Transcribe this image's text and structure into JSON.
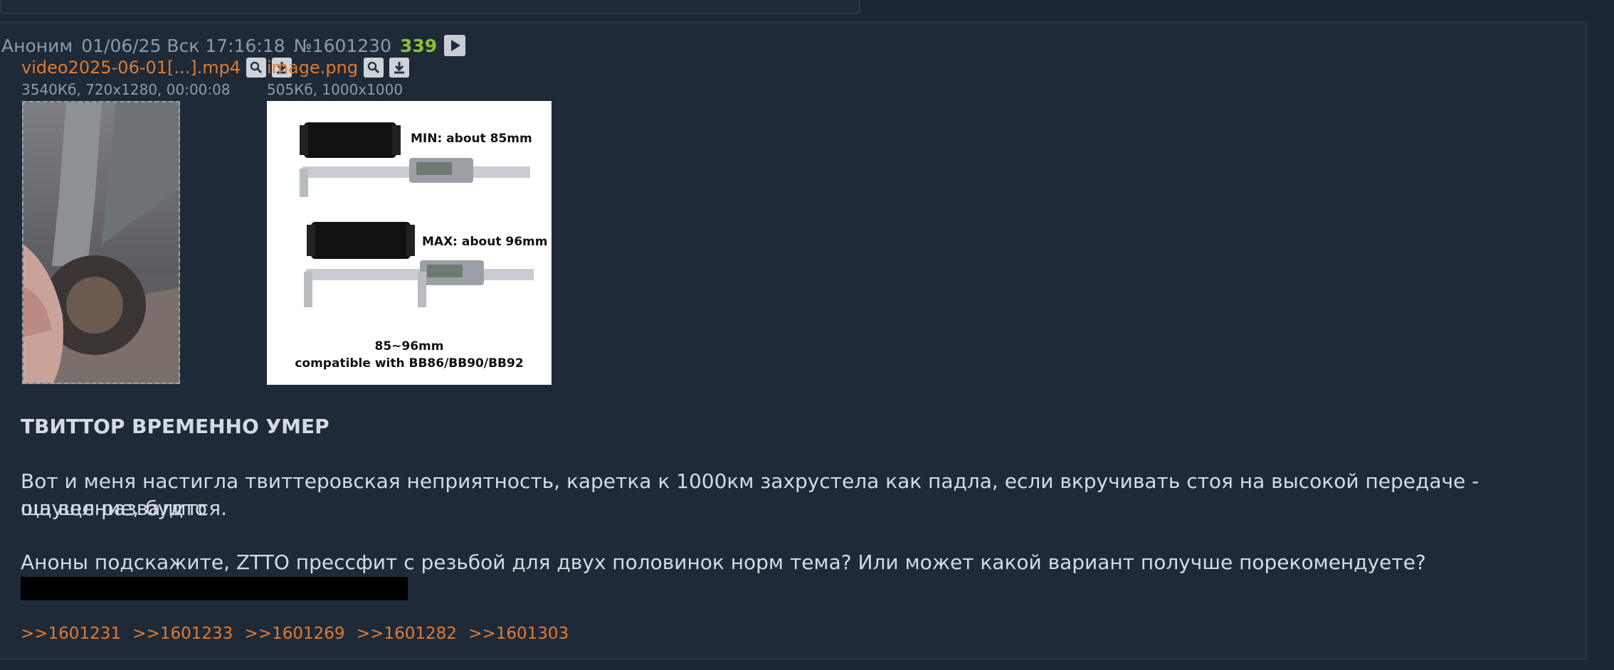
{
  "post": {
    "author": "Аноним",
    "date": "01/06/25 Вск 17:16:18",
    "number": "№1601230",
    "reply_count": "339",
    "files": [
      {
        "name": "video2025-06-01[...].mp4",
        "meta": "3540Кб, 720x1280, 00:00:08"
      },
      {
        "name": "image.png",
        "meta": "505Кб, 1000x1000"
      }
    ],
    "image_text": {
      "min": "MIN: about 85mm",
      "max": "MAX: about 96mm",
      "range": "85~96mm",
      "compat": "compatible with BB86/BB90/BB92"
    },
    "title": "ТВИТТОР ВРЕМЕННО УМЕР",
    "paragraph1_line1": "Вот и меня настигла твиттеровская неприятность, каретка к 1000км захрустела как падла, если вкручивать стоя на высокой передаче - ощущение, будто",
    "paragraph1_line2": "ща вел развалится.",
    "paragraph2": "Аноны подскажите, ZTTO прессфит с резьбой для двух половинок норм тема? Или может какой вариант получше порекомендуете?",
    "replies": [
      ">>1601231",
      ">>1601233",
      ">>1601269",
      ">>1601282",
      ">>1601303"
    ]
  },
  "colors": {
    "background": "#1b2633",
    "post_bg": "#1f2a38",
    "link": "#e07b31",
    "reply_count": "#8fbf3a",
    "meta": "#8f9aa6"
  },
  "icons": [
    "play-icon",
    "search-icon",
    "download-icon"
  ]
}
